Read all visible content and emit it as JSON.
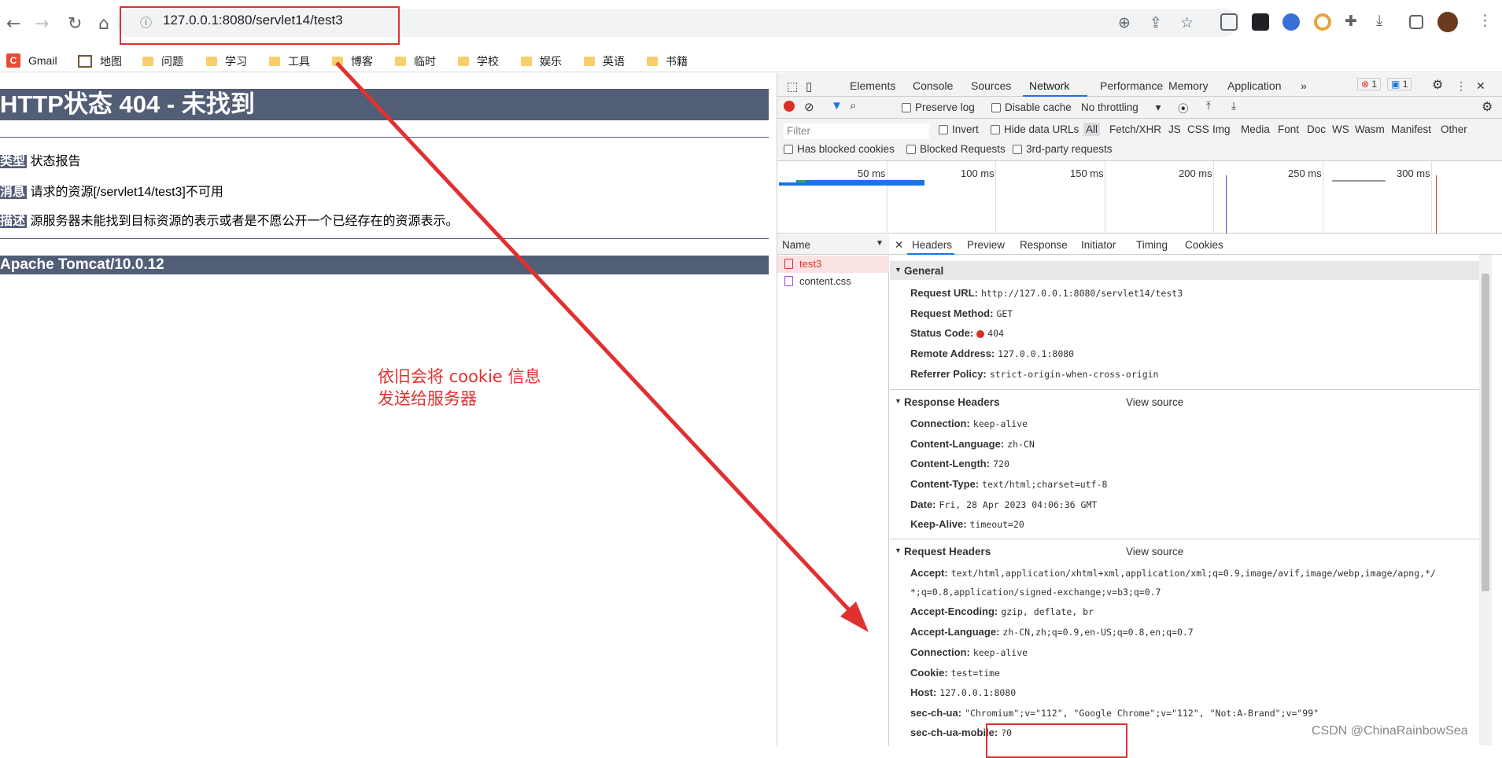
{
  "browser": {
    "url": "127.0.0.1:8080/servlet14/test3",
    "bookmarks": [
      "Gmail",
      "地图",
      "问题",
      "学习",
      "工具",
      "博客",
      "临时",
      "学校",
      "娱乐",
      "英语",
      "书籍"
    ],
    "gmail_letter": "C"
  },
  "page": {
    "title": "HTTP状态 404 - 未找到",
    "rows": [
      {
        "label": "类型",
        "text": " 状态报告"
      },
      {
        "label": "消息",
        "text": " 请求的资源[/servlet14/test3]不可用"
      },
      {
        "label": "描述",
        "text": " 源服务器未能找到目标资源的表示或者是不愿公开一个已经存在的资源表示。"
      }
    ],
    "footer": "Apache Tomcat/10.0.12"
  },
  "annotation": [
    "依旧会将 cookie 信息",
    "发送给服务器"
  ],
  "devtools": {
    "tabs": [
      "Elements",
      "Console",
      "Sources",
      "Network",
      "Performance",
      "Memory",
      "Application"
    ],
    "active_tab": "Network",
    "error_count": "1",
    "msg_count": "1",
    "toolbar": {
      "preserve_log": "Preserve log",
      "disable_cache": "Disable cache",
      "throttling": "No throttling"
    },
    "filter": {
      "placeholder": "Filter",
      "invert": "Invert",
      "hide_data_urls": "Hide data URLs",
      "types": [
        "All",
        "Fetch/XHR",
        "JS",
        "CSS",
        "Img",
        "Media",
        "Font",
        "Doc",
        "WS",
        "Wasm",
        "Manifest",
        "Other"
      ],
      "blocked_cookies": "Has blocked cookies",
      "blocked_requests": "Blocked Requests",
      "third_party": "3rd-party requests"
    },
    "timeline": [
      "50 ms",
      "100 ms",
      "150 ms",
      "200 ms",
      "250 ms",
      "300 ms"
    ],
    "name_header": "Name",
    "requests": [
      "test3",
      "content.css"
    ],
    "detail_tabs": [
      "Headers",
      "Preview",
      "Response",
      "Initiator",
      "Timing",
      "Cookies"
    ],
    "view_source": "View source",
    "general": {
      "title": "General",
      "items": [
        {
          "k": "Request URL:",
          "v": "http://127.0.0.1:8080/servlet14/test3"
        },
        {
          "k": "Request Method:",
          "v": "GET"
        },
        {
          "k": "Status Code:",
          "v": "404"
        },
        {
          "k": "Remote Address:",
          "v": "127.0.0.1:8080"
        },
        {
          "k": "Referrer Policy:",
          "v": "strict-origin-when-cross-origin"
        }
      ]
    },
    "response_headers": {
      "title": "Response Headers",
      "items": [
        {
          "k": "Connection:",
          "v": "keep-alive"
        },
        {
          "k": "Content-Language:",
          "v": "zh-CN"
        },
        {
          "k": "Content-Length:",
          "v": "720"
        },
        {
          "k": "Content-Type:",
          "v": "text/html;charset=utf-8"
        },
        {
          "k": "Date:",
          "v": "Fri, 28 Apr 2023 04:06:36 GMT"
        },
        {
          "k": "Keep-Alive:",
          "v": "timeout=20"
        }
      ]
    },
    "request_headers": {
      "title": "Request Headers",
      "items": [
        {
          "k": "Accept:",
          "v": "text/html,application/xhtml+xml,application/xml;q=0.9,image/avif,image/webp,image/apng,*/"
        },
        {
          "k": "",
          "v": "*;q=0.8,application/signed-exchange;v=b3;q=0.7"
        },
        {
          "k": "Accept-Encoding:",
          "v": "gzip, deflate, br"
        },
        {
          "k": "Accept-Language:",
          "v": "zh-CN,zh;q=0.9,en-US;q=0.8,en;q=0.7"
        },
        {
          "k": "Connection:",
          "v": "keep-alive"
        },
        {
          "k": "Cookie:",
          "v": "test=time"
        },
        {
          "k": "Host:",
          "v": "127.0.0.1:8080"
        },
        {
          "k": "sec-ch-ua:",
          "v": "\"Chromium\";v=\"112\", \"Google Chrome\";v=\"112\", \"Not:A-Brand\";v=\"99\""
        },
        {
          "k": "sec-ch-ua-mobile:",
          "v": "?0"
        }
      ]
    }
  },
  "watermark": "CSDN @ChinaRainbowSea"
}
